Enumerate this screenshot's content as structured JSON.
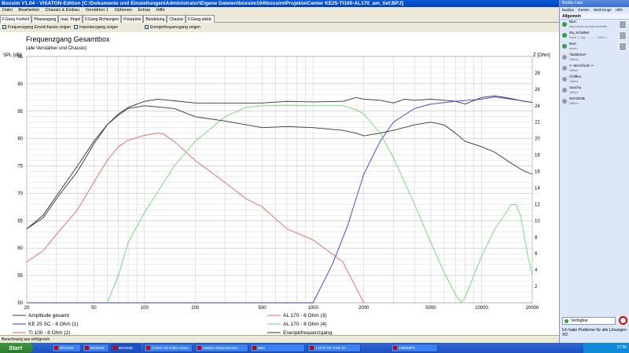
{
  "window": {
    "title": "Boxsim V1.04 - VISATON-Edition [C:\\Dokumente und Einstellungen\\Administrator\\Eigene Dateien\\boxsim104\\boxsim\\Projekte\\Center KE25-TI100-AL170_am_tief.BPJ]"
  },
  "menu": [
    "Datei",
    "Bearbeiten",
    "Chassis & Einbau",
    "Verstärker 1",
    "Optionen",
    "Extras",
    "Hilfe"
  ],
  "tabs": [
    "F.Gang Freifeld",
    "Phasengang",
    "max. Pegel",
    "F.Gang Richtungen",
    "Polarplots",
    "Bündelung",
    "Chassis",
    "F.Gang elektr."
  ],
  "options": {
    "opt1": "Frequenzgang Einzelchassis zeigen",
    "opt2": "Impedanzgang zeigen",
    "opt3": "Energiefrequenzgang zeigen"
  },
  "chart_data": {
    "type": "line",
    "title": "Frequenzgang Gesamtbox",
    "subtitle": "(alle Verstärker und Chassis)",
    "ylabel_left": "SPL [dB]",
    "ylabel_right": "Z [Ohm]",
    "xscale": "log",
    "xlim": [
      20,
      20000
    ],
    "ylim_left": [
      50,
      95
    ],
    "ylim_right": [
      0,
      30
    ],
    "grid": true,
    "x_ticks": [
      "20",
      "50",
      "100",
      "200",
      "500",
      "1000",
      "2000",
      "5000",
      "10000",
      "20000"
    ],
    "y_ticks_left": [
      "95",
      "90",
      "85",
      "80",
      "75",
      "70",
      "65",
      "60",
      "55",
      "50"
    ],
    "y_ticks_right": [
      "28",
      "26",
      "24",
      "22",
      "20",
      "18",
      "16",
      "14",
      "12",
      "10",
      "8",
      "6",
      "4",
      "2"
    ],
    "series": [
      {
        "name": "Amplitude gesamt",
        "color": "#333333",
        "axis": "left",
        "points": [
          [
            20,
            63.5
          ],
          [
            25,
            65.5
          ],
          [
            30,
            69
          ],
          [
            40,
            74
          ],
          [
            50,
            79
          ],
          [
            60,
            82.5
          ],
          [
            70,
            84.5
          ],
          [
            80,
            85.7
          ],
          [
            100,
            86.8
          ],
          [
            120,
            87.2
          ],
          [
            150,
            86.9
          ],
          [
            200,
            86.5
          ],
          [
            300,
            86.5
          ],
          [
            500,
            86.5
          ],
          [
            700,
            86.8
          ],
          [
            1000,
            86.7
          ],
          [
            1500,
            86.8
          ],
          [
            1800,
            87.5
          ],
          [
            2000,
            87.2
          ],
          [
            2500,
            87.0
          ],
          [
            3000,
            86.5
          ],
          [
            3500,
            87.2
          ],
          [
            4000,
            87.0
          ],
          [
            5000,
            87.2
          ],
          [
            6000,
            87.0
          ],
          [
            7000,
            86.8
          ],
          [
            8000,
            86.3
          ],
          [
            10000,
            87.5
          ],
          [
            12000,
            87.8
          ],
          [
            15000,
            87.3
          ],
          [
            18000,
            86.8
          ],
          [
            20000,
            86.6
          ]
        ]
      },
      {
        "name": "KE 25 SC - 8 Ohm   (1)",
        "color": "#3a3ad0",
        "axis": "left",
        "points": [
          [
            20,
            50
          ],
          [
            1000,
            50
          ],
          [
            1300,
            57
          ],
          [
            1600,
            64
          ],
          [
            2000,
            73.5
          ],
          [
            2500,
            79.5
          ],
          [
            3000,
            83
          ],
          [
            4000,
            85.5
          ],
          [
            5000,
            86.3
          ],
          [
            7000,
            86.8
          ],
          [
            10000,
            87.2
          ],
          [
            12000,
            87.6
          ],
          [
            15000,
            87.2
          ],
          [
            20000,
            86.6
          ]
        ]
      },
      {
        "name": "TI 100 - 8 Ohm (2)",
        "color": "#e06565",
        "axis": "left",
        "points": [
          [
            20,
            57.5
          ],
          [
            25,
            59.5
          ],
          [
            30,
            62.5
          ],
          [
            40,
            67
          ],
          [
            50,
            72
          ],
          [
            60,
            76
          ],
          [
            70,
            78.5
          ],
          [
            80,
            79.7
          ],
          [
            100,
            80.6
          ],
          [
            120,
            81.0
          ],
          [
            130,
            80.8
          ],
          [
            150,
            79.5
          ],
          [
            200,
            76
          ],
          [
            300,
            72
          ],
          [
            400,
            69
          ],
          [
            500,
            67.5
          ],
          [
            700,
            63.5
          ],
          [
            1000,
            61.5
          ],
          [
            1500,
            57.5
          ],
          [
            2000,
            50
          ]
        ]
      },
      {
        "name": "AL 170 - 8 Ohm (3)",
        "color": "#66dd66",
        "axis": "left",
        "points": [
          [
            60,
            50
          ],
          [
            70,
            55
          ],
          [
            80,
            61
          ],
          [
            100,
            66.5
          ],
          [
            150,
            75
          ],
          [
            200,
            79.5
          ],
          [
            300,
            84
          ],
          [
            400,
            85.7
          ],
          [
            500,
            86
          ],
          [
            700,
            86.1
          ],
          [
            1000,
            86
          ],
          [
            1500,
            86
          ],
          [
            1800,
            85.3
          ],
          [
            2000,
            84.5
          ],
          [
            2500,
            81
          ],
          [
            3000,
            76.5
          ],
          [
            4000,
            68
          ],
          [
            5000,
            61
          ],
          [
            6000,
            55.5
          ],
          [
            7000,
            51.5
          ],
          [
            7600,
            50
          ],
          [
            8000,
            51
          ],
          [
            9000,
            55
          ],
          [
            10000,
            58.5
          ],
          [
            12000,
            63.5
          ],
          [
            14000,
            66.5
          ],
          [
            15000,
            68
          ],
          [
            16000,
            68
          ],
          [
            17000,
            66
          ],
          [
            19000,
            58
          ],
          [
            20000,
            55
          ]
        ]
      },
      {
        "name": "Energiefrequenzgang",
        "color": "#333333",
        "axis": "left",
        "points": [
          [
            20,
            63.5
          ],
          [
            25,
            66
          ],
          [
            30,
            69.5
          ],
          [
            40,
            75
          ],
          [
            50,
            79.5
          ],
          [
            60,
            82.5
          ],
          [
            70,
            84.3
          ],
          [
            80,
            85.5
          ],
          [
            100,
            86.0
          ],
          [
            150,
            85.5
          ],
          [
            200,
            84.0
          ],
          [
            300,
            83.2
          ],
          [
            500,
            82.0
          ],
          [
            700,
            82.2
          ],
          [
            1000,
            82.0
          ],
          [
            1500,
            81.5
          ],
          [
            1800,
            81.0
          ],
          [
            2000,
            80.5
          ],
          [
            2500,
            81.0
          ],
          [
            3000,
            81.5
          ],
          [
            4000,
            82.5
          ],
          [
            5000,
            83.0
          ],
          [
            6000,
            82.5
          ],
          [
            7000,
            81.0
          ],
          [
            8000,
            79.5
          ],
          [
            10000,
            78.5
          ],
          [
            12000,
            77.5
          ],
          [
            15000,
            75.5
          ],
          [
            18000,
            74
          ],
          [
            20000,
            73.5
          ]
        ]
      }
    ],
    "legend": {
      "placement": "bottom",
      "items": [
        {
          "label": "Amplitude gesamt",
          "color": "#333333"
        },
        {
          "label": "KE 25 SC - 8 Ohm   (1)",
          "color": "#3a3ad0"
        },
        {
          "label": "TI 100 - 8 Ohm (2)",
          "color": "#e06565"
        },
        {
          "label": "AL 170 - 8 Ohm (3)",
          "color": "#e06565"
        },
        {
          "label": "AL 170 - 8 Ohm (4)",
          "color": "#66dd66"
        },
        {
          "label": "Energiefrequenzgang",
          "color": "#333333"
        }
      ]
    }
  },
  "status": "Berechnung war erfolgreich",
  "messenger": {
    "title": "Buddy-Liste",
    "menu": [
      "Buddys",
      "Gesten",
      "Werkzeuge",
      "Hilfe"
    ],
    "group": "Allgemein",
    "contacts": [
      {
        "name": "Bazi",
        "status": "http://www.mousify.de/trefff...",
        "online": true
      },
      {
        "name": "Da_Schalker",
        "status": "Noch 1 Tag..............\"DEU...",
        "online": true
      },
      {
        "name": "Borc",
        "status": "wech...",
        "online": true
      },
      {
        "name": "*Dubbone*",
        "status": "Offline",
        "online": false
      },
      {
        "name": "<--terrorfood-->",
        "status": "Offline",
        "online": false
      },
      {
        "name": "Chillkro",
        "status": "Offline",
        "online": false
      },
      {
        "name": "Sanchu",
        "status": "Offline",
        "online": false
      },
      {
        "name": "SOHOOB",
        "status": "Offline",
        "online": false
      }
    ],
    "status_select": "Verfügbar",
    "message": "Ich habe Probleme für alle Lösungen XD"
  },
  "taskbar": {
    "start": "Start",
    "tasks": [
      "BOXSIM",
      "BOXSIM",
      "BOXSIM",
      "Center mit selber Koax...",
      "Visaton Diskussionsfo...",
      "Bazi",
      "1 [4/7] CD Track 07 ...",
      "1360/MPH"
    ],
    "clock": "17:30"
  }
}
